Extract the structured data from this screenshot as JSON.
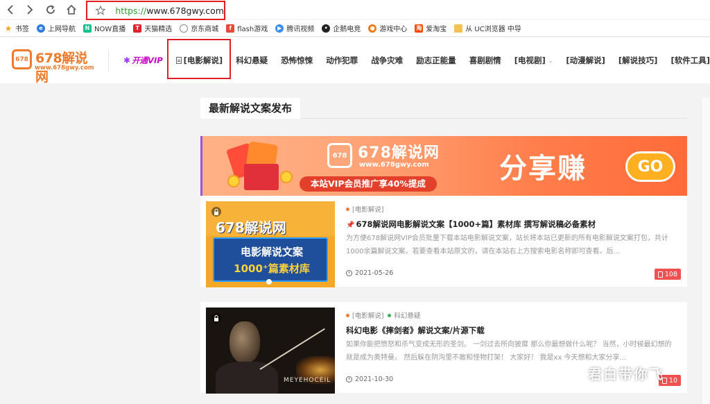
{
  "browser": {
    "url_scheme": "https://",
    "url_host": "www.678gwy.com",
    "bookmarks": [
      {
        "label": "书签",
        "icon": "star-icon",
        "color": "#f5a623"
      },
      {
        "label": "上网导航",
        "icon": "browser-e-icon",
        "color": "#2a7de1"
      },
      {
        "label": "NOW直播",
        "icon": "now-live-icon",
        "color": "#12c28a"
      },
      {
        "label": "天猫精选",
        "icon": "tmall-icon",
        "color": "#e0232b"
      },
      {
        "label": "京东商城",
        "icon": "globe-icon",
        "color": "#888888"
      },
      {
        "label": "flash游戏",
        "icon": "flash-icon",
        "color": "#e84a3a"
      },
      {
        "label": "腾讯视频",
        "icon": "tencent-video-icon",
        "color": "#3a8ef0"
      },
      {
        "label": "企鹅电竞",
        "icon": "penguin-icon",
        "color": "#222222"
      },
      {
        "label": "游戏中心",
        "icon": "gamepad-icon",
        "color": "#f07a1a"
      },
      {
        "label": "爱淘宝",
        "icon": "taobao-icon",
        "color": "#ff4a00"
      },
      {
        "label": "从 UC浏览器 中导",
        "icon": "folder-icon",
        "color": "#f2c255"
      }
    ]
  },
  "site": {
    "logo_title": "678解说网",
    "logo_sub": "www.678gwy.com",
    "logo_mark": "678",
    "menu": {
      "vip": "开通VIP",
      "movie": "[电影解说]",
      "scifi": "科幻悬疑",
      "horror": "恐怖惊悚",
      "action": "动作犯罪",
      "war": "战争灾难",
      "inspire": "励志正能量",
      "comedy": "喜剧剧情",
      "tv": "[电视剧]",
      "anime": "[动漫解说]",
      "tips": "[解说技巧]",
      "tools": "[软件工具]"
    },
    "accent_color": "#ef7a2a"
  },
  "main": {
    "section_title": "最新解说文案发布",
    "banner": {
      "logo_title": "678解说网",
      "logo_sub": "www.678gwy.com",
      "promo": "本站VIP会员推广享40%提成",
      "slogan": "分享赚",
      "go": "GO"
    },
    "posts": [
      {
        "category": "[电影解说]",
        "category_color": "#f07a3a",
        "title": "678解说网电影解说文案【1000+篇】素材库 撰写解说稿必备素材",
        "excerpt": "为方便678解说网VIP会员批量下载本站电影解说文案，站长将本站已更新的所有电影解说文案打包，共计1000余篇解说文案。若要查看本站原文的，请在本站右上方搜索电影名称即可查看。后...",
        "date": "2021-05-26",
        "count": "108",
        "thumb_title": "678解说网",
        "thumb_line1": "电影解说文案",
        "thumb_line2": "1000⁺篇素材库"
      },
      {
        "category": "[电影解说]",
        "category_color": "#f07a3a",
        "subcategory": "科幻悬疑",
        "subcategory_color": "#3ab050",
        "title": "科幻电影《摔剑者》解说文案/片源下载",
        "excerpt": "如果你能把愤怒和杀气变成无形的圣剑。 一剑过去所向披靡 那么你最想做什么呢？ 当然，小时候最幻想的就是成为奥特曼。 然后躲在阴沟里不敢和怪物打架！ 大家好！ 我是xx 今天想和大家分享...",
        "date": "2021-10-30",
        "count": "10",
        "thumb_text": "MEYEHOCEIL"
      }
    ]
  },
  "watermark": "君白带你飞"
}
